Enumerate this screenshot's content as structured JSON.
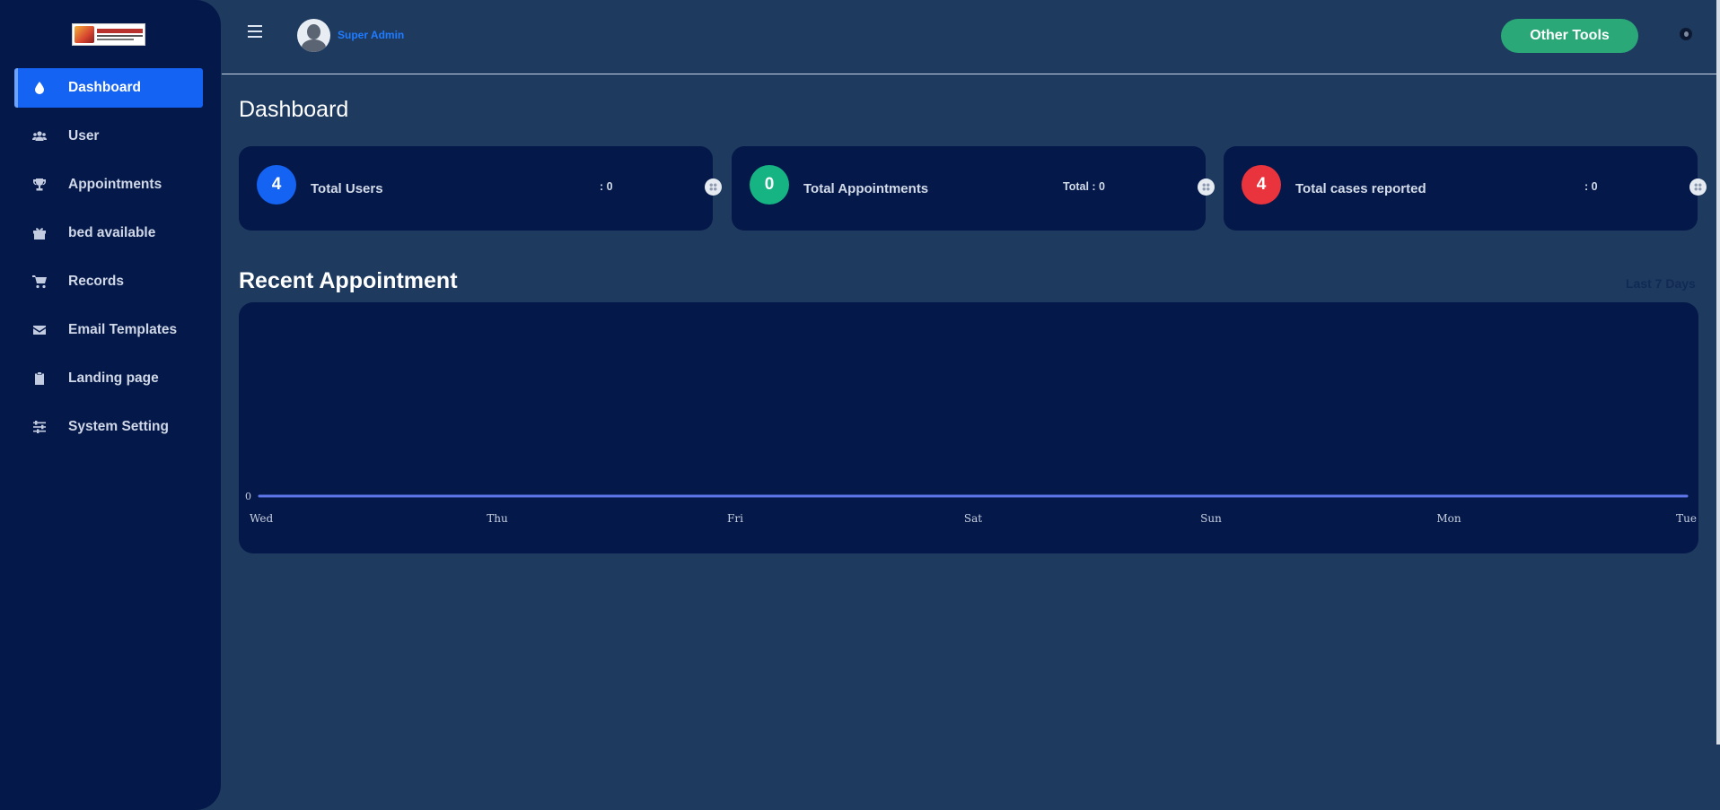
{
  "sidebar": {
    "logo_text": "AJEENKYA",
    "items": [
      {
        "label": "Dashboard",
        "icon": "drop-icon",
        "active": true
      },
      {
        "label": "User",
        "icon": "users-icon"
      },
      {
        "label": "Appointments",
        "icon": "trophy-icon"
      },
      {
        "label": "bed available",
        "icon": "gift-icon"
      },
      {
        "label": "Records",
        "icon": "cart-icon"
      },
      {
        "label": "Email Templates",
        "icon": "envelope-icon"
      },
      {
        "label": "Landing page",
        "icon": "clipboard-icon"
      },
      {
        "label": "System Setting",
        "icon": "sliders-icon"
      }
    ]
  },
  "header": {
    "user_name": "Super Admin",
    "other_tools_label": "Other Tools"
  },
  "main": {
    "title": "Dashboard",
    "stats": [
      {
        "count": "4",
        "label": "Total Users",
        "value": ": 0",
        "color": "#1463f3"
      },
      {
        "count": "0",
        "label": "Total Appointments",
        "value": "Total : 0",
        "color": "#16b383"
      },
      {
        "count": "4",
        "label": "Total cases reported",
        "value": ": 0",
        "color": "#e9333d"
      }
    ],
    "recent_title": "Recent Appointment",
    "range_label": "Last 7 Days"
  },
  "chart_data": {
    "type": "line",
    "categories": [
      "Wed",
      "Thu",
      "Fri",
      "Sat",
      "Sun",
      "Mon",
      "Tue"
    ],
    "series": [
      {
        "values": [
          0,
          0,
          0,
          0,
          0,
          0,
          0
        ],
        "color": "#5d75e6"
      }
    ],
    "y_tick_labels": [
      "0"
    ],
    "grid": false
  }
}
